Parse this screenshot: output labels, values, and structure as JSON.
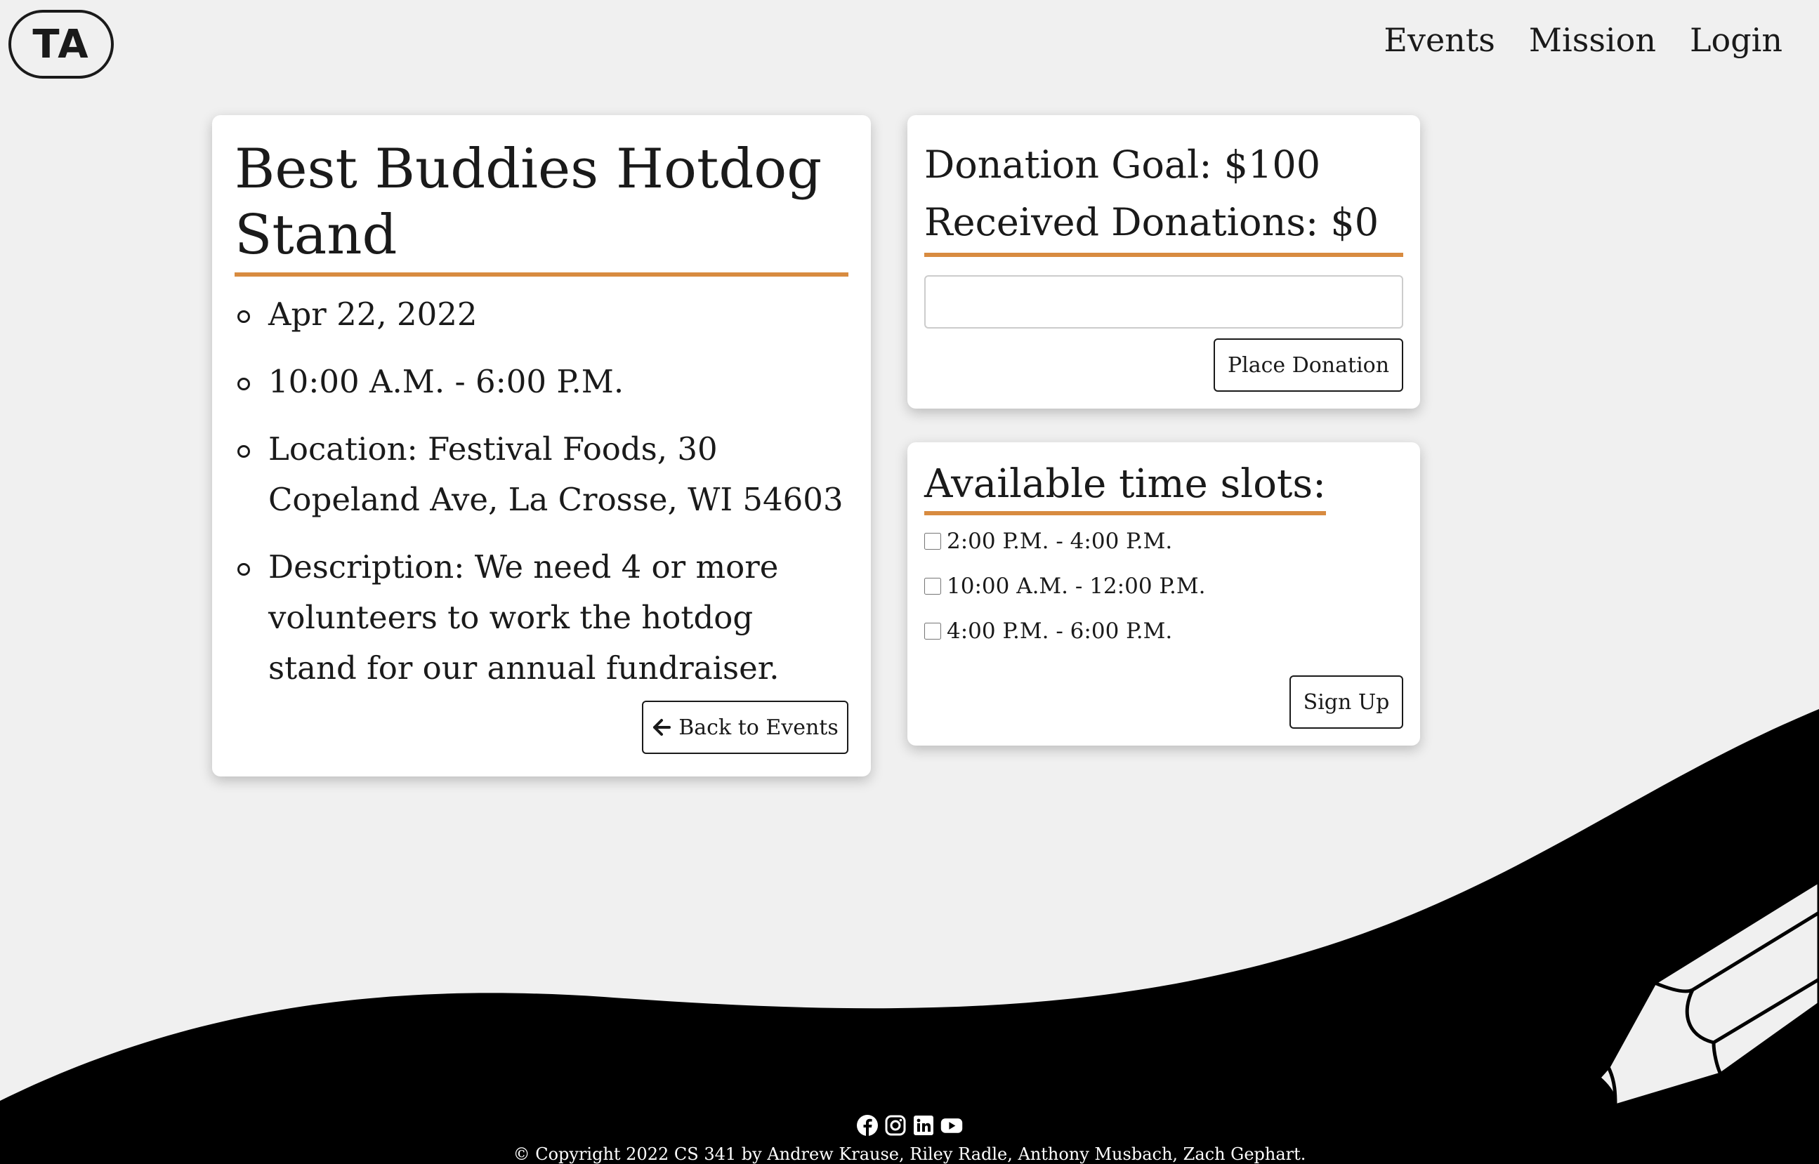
{
  "header": {
    "logo_text": "TA",
    "nav": [
      "Events",
      "Mission",
      "Login"
    ]
  },
  "event": {
    "title": "Best Buddies Hotdog Stand",
    "date": "Apr 22, 2022",
    "time": "10:00 A.M. - 6:00 P.M.",
    "location": "Location: Festival Foods, 30 Copeland Ave, La Crosse, WI 54603",
    "description": "Description: We need 4 or more volunteers to work the hotdog stand for our annual fundraiser.",
    "back_label": "Back to Events",
    "back_icon": "arrow-left-icon"
  },
  "donation": {
    "goal_text": "Donation Goal: $100",
    "received_text": "Received Donations: $0",
    "input_value": "",
    "button_label": "Place Donation"
  },
  "slots": {
    "title": "Available time slots:",
    "options": [
      "2:00 P.M. - 4:00 P.M.",
      "10:00 A.M. - 12:00 P.M.",
      "4:00 P.M. - 6:00 P.M."
    ],
    "button_label": "Sign Up"
  },
  "footer": {
    "social_icons": [
      "facebook-icon",
      "instagram-icon",
      "linkedin-icon",
      "youtube-icon"
    ],
    "copyright": "© Copyright 2022 CS 341 by Andrew Krause, Riley Radle, Anthony Musbach, Zach Gephart."
  },
  "colors": {
    "background": "#f0f0f0",
    "accent": "#d88b40",
    "footer": "#000000"
  }
}
